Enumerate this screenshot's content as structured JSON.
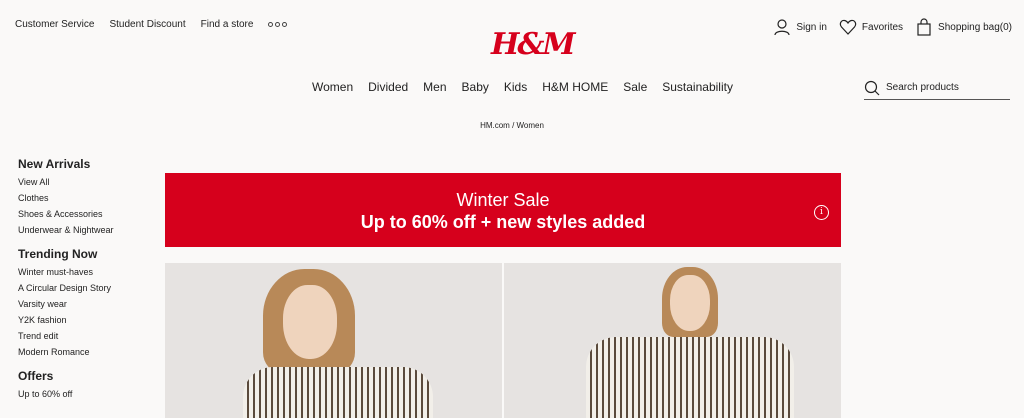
{
  "topbar": {
    "links": [
      "Customer Service",
      "Student Discount",
      "Find a store"
    ],
    "more_icon": "more-dots-icon"
  },
  "logo": "H&M",
  "account": {
    "sign_in": "Sign in",
    "favorites": "Favorites",
    "shopping_bag": "Shopping bag(0)"
  },
  "nav": [
    "Women",
    "Divided",
    "Men",
    "Baby",
    "Kids",
    "H&M HOME",
    "Sale",
    "Sustainability"
  ],
  "search": {
    "placeholder": "Search products"
  },
  "breadcrumb": "HM.com / Women",
  "sidebar": [
    {
      "heading": "New Arrivals",
      "items": [
        "View All",
        "Clothes",
        "Shoes & Accessories",
        "Underwear & Nightwear"
      ]
    },
    {
      "heading": "Trending Now",
      "items": [
        "Winter must-haves",
        "A Circular Design Story",
        "Varsity wear",
        "Y2K fashion",
        "Trend edit",
        "Modern Romance"
      ]
    },
    {
      "heading": "Offers",
      "items": [
        "Up to 60% off"
      ]
    }
  ],
  "banner": {
    "title": "Winter Sale",
    "subtitle": "Up to 60% off + new styles added",
    "color": "#d6001c"
  }
}
